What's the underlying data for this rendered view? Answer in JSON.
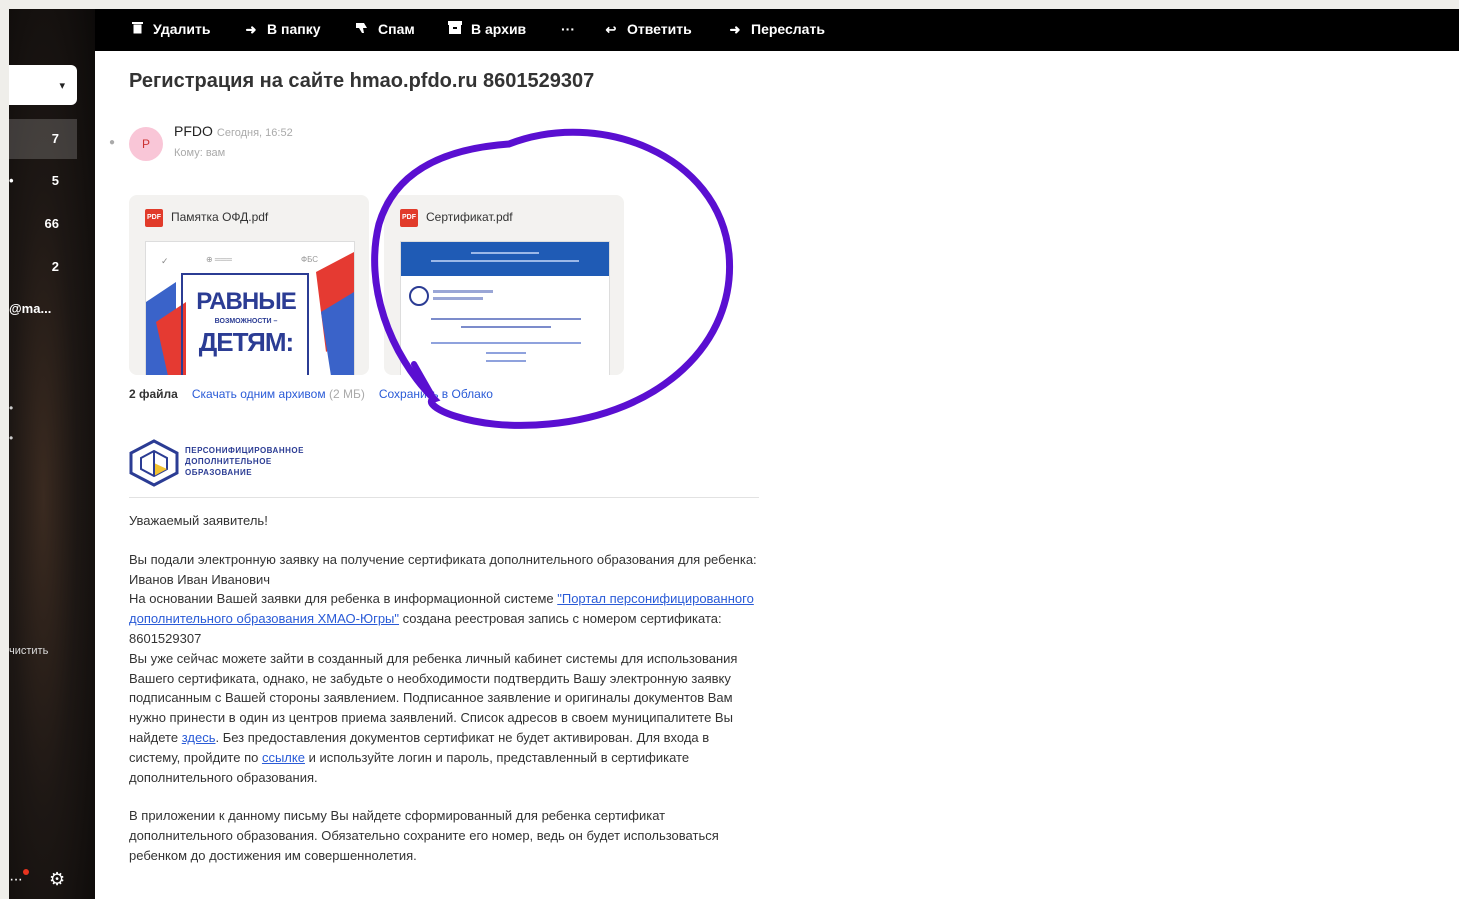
{
  "toolbar": {
    "delete": "Удалить",
    "to_folder": "В папку",
    "spam": "Спам",
    "archive": "В архив",
    "more": "···",
    "reply": "Ответить",
    "forward": "Переслать"
  },
  "sidebar": {
    "compose_caret": "▾",
    "counts": [
      "7",
      "5",
      "66",
      "2"
    ],
    "email": "@ma...",
    "clean_label": "чистить",
    "more_label": "···"
  },
  "message": {
    "subject": "Регистрация на сайте hmao.pfdo.ru 8601529307",
    "avatar_letter": "P",
    "sender": "PFDO",
    "date": "Сегодня, 16:52",
    "to": "Кому: вам",
    "attachments": [
      {
        "name": "Памятка ОФД.pdf",
        "thumb_line1": "РАВНЫЕ",
        "thumb_line2": "ВОЗМОЖНОСТИ –",
        "thumb_line3": "ДЕТЯМ:"
      },
      {
        "name": "Сертификат.pdf"
      }
    ],
    "files_count": "2 файла",
    "download_all": "Скачать одним архивом",
    "download_size": "(2 МБ)",
    "save_cloud": "Сохранить в Облако",
    "logo_text": [
      "ПЕРСОНИФИЦИРОВАННОЕ",
      "ДОПОЛНИТЕЛЬНОЕ",
      "ОБРАЗОВАНИЕ"
    ],
    "greeting": "Уважаемый заявитель!",
    "p1": {
      "t1": "Вы подали электронную заявку на получение сертификата дополнительного образования для ребенка: Иванов Иван Иванович",
      "t2": "На основании Вашей заявки для ребенка в информационной системе ",
      "link_portal": "\"Портал персонифицированного дополнительного образования ХМАО-Югры\"",
      "t3": " создана реестровая запись с номером сертификата: 8601529307",
      "t4": "Вы уже сейчас можете зайти в созданный для ребенка личный кабинет системы для использования Вашего сертификата, однако, не забудьте о необходимости подтвердить Вашу электронную заявку подписанным с Вашей стороны заявлением. Подписанное заявление и оригиналы документов Вам нужно принести в один из центров приема заявлений. Список адресов в своем муниципалитете Вы найдете ",
      "link_here": "здесь",
      "t5": ". Без предоставления документов сертификат не будет активирован. Для входа в систему, пройдите по ",
      "link_ref": "ссылке",
      "t6": " и используйте логин и пароль, представленный в сертификате дополнительного образования."
    },
    "p2": "В приложении к данному письму Вы найдете сформированный для ребенка сертификат дополнительного образования. Обязательно сохраните его номер, ведь он будет использоваться ребенком до достижения им совершеннолетия."
  },
  "colors": {
    "annotation_circle": "#5a0fd1",
    "link": "#2a5bd7",
    "pdf_icon": "#e13b2a",
    "toolbar_bg": "#000000"
  }
}
